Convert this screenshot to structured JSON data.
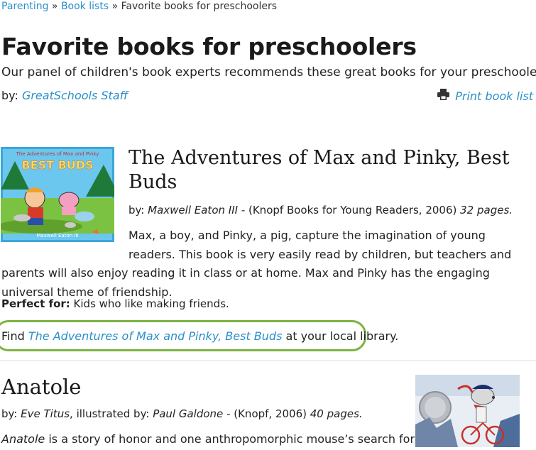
{
  "breadcrumb": {
    "items": [
      "Parenting",
      "Book lists"
    ],
    "current": "Favorite books for preschoolers",
    "separator": "»"
  },
  "page": {
    "title": "Favorite books for preschoolers",
    "intro": "Our panel of children's book experts recommends these great books for your preschooler.",
    "by_label": "by:",
    "author": "GreatSchools Staff",
    "print_label": "Print book list",
    "print_icon": "printer-icon"
  },
  "books": [
    {
      "title": "The Adventures of Max and Pinky, Best Buds",
      "cover_title": "The Adventures of Max and Pinky",
      "cover_subtitle": "BEST BUDS",
      "cover_author": "Maxwell Eaton III",
      "by_label": "by:",
      "author": "Maxwell Eaton III",
      "publisher": " - (Knopf Books for Young Readers, 2006) ",
      "pages": "32 pages.",
      "description": "Max, a boy, and Pinky, a pig, capture the imagination of young readers. This book is very easily read by children, but teachers and parents will also enjoy reading it in class or at home. Max and Pinky has the engaging universal theme of friendship.",
      "perfect_for_label": "Perfect for:",
      "perfect_for": " Kids who like making friends.",
      "find_prefix": "Find ",
      "find_suffix": " at your local library."
    },
    {
      "title": "Anatole",
      "by_label": "by:",
      "author": "Eve Titus",
      "illustrated_label": ", illustrated by: ",
      "illustrator": "Paul Galdone",
      "publisher": " - (Knopf, 2006) ",
      "pages": "40 pages.",
      "description_title": "Anatole",
      "description": " is a story of honor and one anthropomorphic mouse’s search for"
    }
  ],
  "colors": {
    "link": "#2b8fc8",
    "highlight_border": "#7cb342"
  }
}
